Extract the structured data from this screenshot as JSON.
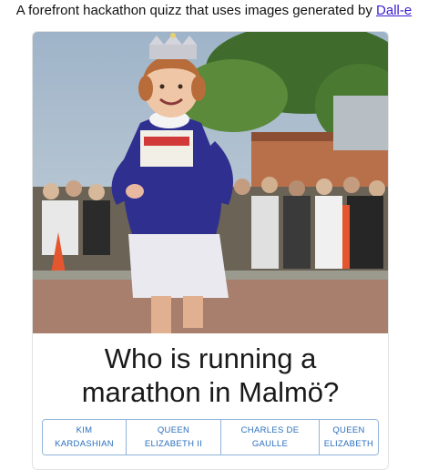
{
  "header": {
    "text": "A forefront hackathon quizz that uses images generated by",
    "link_label": "Dall-e"
  },
  "question": {
    "line1": "Who is running a",
    "line2": "marathon in Malmö?"
  },
  "answers": [
    {
      "line1": "KIM",
      "line2": "KARDASHIAN"
    },
    {
      "line1": "QUEEN",
      "line2": "ELIZABETH II"
    },
    {
      "line1": "CHARLES DE",
      "line2": "GAULLE"
    },
    {
      "line1": "QUEEN",
      "line2": "ELIZABETH"
    }
  ],
  "colors": {
    "link": "#3b1fd1",
    "answer_text": "#2a6fbe",
    "answer_border": "#8fb3d9"
  }
}
